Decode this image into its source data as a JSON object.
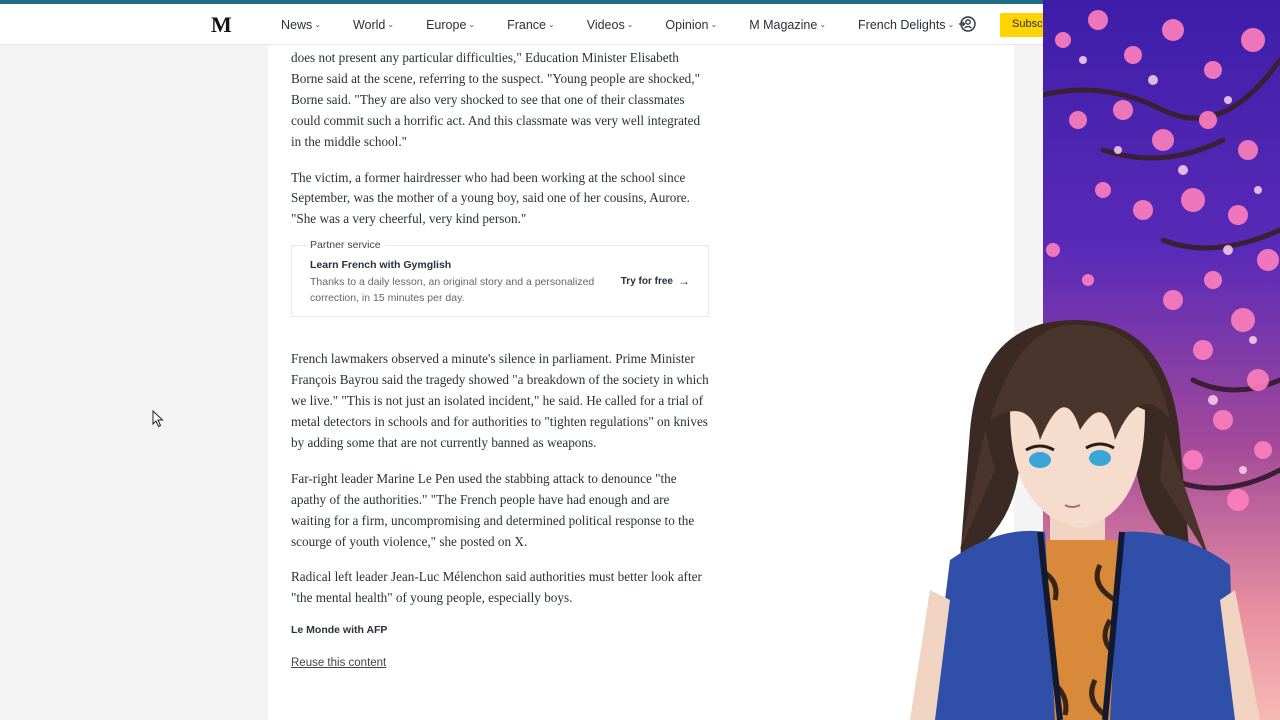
{
  "header": {
    "logo": "M",
    "nav": [
      "News",
      "World",
      "Europe",
      "France",
      "Videos",
      "Opinion",
      "M Magazine",
      "French Delights"
    ],
    "subscribe_label": "Subscribe"
  },
  "article": {
    "p1": "does not present any particular difficulties,\" Education Minister Elisabeth Borne said at the scene, referring to the suspect. \"Young people are shocked,\" Borne said. \"They are also very shocked to see that one of their classmates could commit such a horrific act. And this classmate was very well integrated in the middle school.\"",
    "p2": "The victim, a former hairdresser who had been working at the school since September, was the mother of a young boy, said one of her cousins, Aurore. \"She was a very cheerful, very kind person.\"",
    "partner": {
      "tag": "Partner service",
      "title": "Learn French with Gymglish",
      "description": "Thanks to a daily lesson, an original story and a personalized correction, in 15 minutes per day.",
      "cta": "Try for free"
    },
    "p3": "French lawmakers observed a minute's silence in parliament. Prime Minister François Bayrou said the tragedy showed \"a breakdown of the society in which we live.\" \"This is not just an isolated incident,\" he said. He called for a trial of metal detectors in schools and for authorities to \"tighten regulations\" on knives by adding some that are not currently banned as weapons.",
    "p4": "Far-right leader Marine Le Pen used the stabbing attack to denounce \"the apathy of the authorities.\" \"The French people have had enough and are waiting for a firm, uncompromising and determined political response to the scourge of youth violence,\" she posted on X.",
    "p5": "Radical left leader Jean-Luc Mélenchon said authorities must better look after \"the mental health\" of young people, especially boys.",
    "credit": "Le Monde with AFP",
    "reuse": "Reuse this content"
  },
  "colors": {
    "accent": "#1e6d84",
    "subscribe": "#ffd400",
    "overlay_top": "#3d1ea8",
    "overlay_bottom": "#f7b9b3"
  },
  "icons": [
    "login-icon",
    "arrow-right-icon",
    "chevron-down-icon",
    "mouse-cursor-icon"
  ]
}
